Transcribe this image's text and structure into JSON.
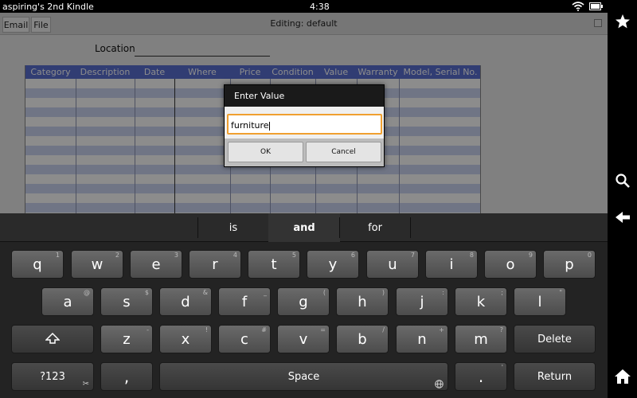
{
  "status": {
    "device_name": "aspiring's 2nd Kindle",
    "time": "4:38"
  },
  "toolbar": {
    "email_label": "Email",
    "file_label": "File",
    "title": "Editing: default"
  },
  "form": {
    "location_label": "Location"
  },
  "grid": {
    "columns": [
      "Category",
      "Description",
      "Date",
      "Where",
      "Price",
      "Condition",
      "Value",
      "Warranty",
      "Model, Serial No."
    ]
  },
  "dialog": {
    "title": "Enter Value",
    "value": "furniture",
    "ok_label": "OK",
    "cancel_label": "Cancel"
  },
  "keyboard": {
    "suggestions": [
      "is",
      "and",
      "for"
    ],
    "row1": [
      {
        "key": "q",
        "hint": "1"
      },
      {
        "key": "w",
        "hint": "2"
      },
      {
        "key": "e",
        "hint": "3"
      },
      {
        "key": "r",
        "hint": "4"
      },
      {
        "key": "t",
        "hint": "5"
      },
      {
        "key": "y",
        "hint": "6"
      },
      {
        "key": "u",
        "hint": "7"
      },
      {
        "key": "i",
        "hint": "8"
      },
      {
        "key": "o",
        "hint": "9"
      },
      {
        "key": "p",
        "hint": "0"
      }
    ],
    "row2": [
      {
        "key": "a",
        "hint": "@"
      },
      {
        "key": "s",
        "hint": "$"
      },
      {
        "key": "d",
        "hint": "&"
      },
      {
        "key": "f",
        "hint": "_"
      },
      {
        "key": "g",
        "hint": "("
      },
      {
        "key": "h",
        "hint": ")"
      },
      {
        "key": "j",
        "hint": ":"
      },
      {
        "key": "k",
        "hint": ";"
      },
      {
        "key": "l",
        "hint": "\""
      }
    ],
    "row3": [
      {
        "key": "z",
        "hint": "-"
      },
      {
        "key": "x",
        "hint": "!"
      },
      {
        "key": "c",
        "hint": "#"
      },
      {
        "key": "v",
        "hint": "="
      },
      {
        "key": "b",
        "hint": "/"
      },
      {
        "key": "n",
        "hint": "+"
      },
      {
        "key": "m",
        "hint": "?"
      }
    ],
    "delete_label": "Delete",
    "symbols_label": "?123",
    "comma_label": ",",
    "space_label": "Space",
    "period_label": ".",
    "period_hint": "'",
    "return_label": "Return"
  },
  "icons": {
    "wifi": "wifi-icon",
    "battery": "battery-icon",
    "favorites": "star-icon",
    "search": "search-icon",
    "back": "back-arrow-icon",
    "home": "home-icon",
    "shift": "shift-icon",
    "scissors": "scissors-icon",
    "globe": "globe-icon"
  },
  "colors": {
    "grid_header": "#5a6fd1",
    "grid_alt_row": "#cdd5f3",
    "input_focus": "#f0a030"
  }
}
